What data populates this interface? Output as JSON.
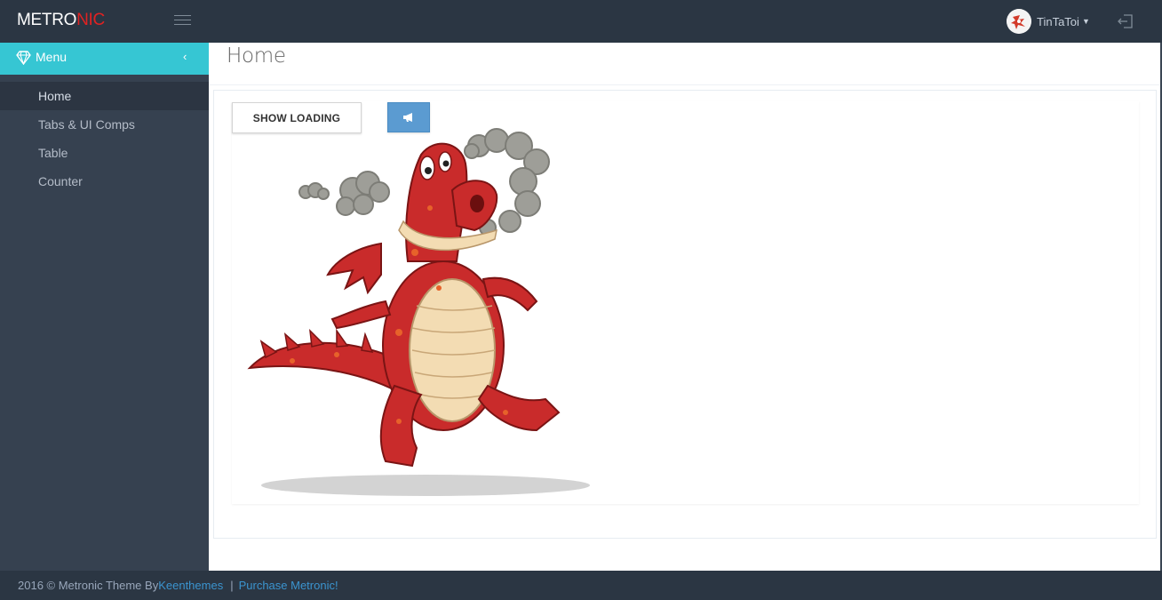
{
  "header": {
    "logo_main": "METRO",
    "logo_accent": "NIC",
    "username": "TinTaToi",
    "icons": [
      "hamburger-icon",
      "avatar",
      "chevron-down-icon",
      "logout-icon"
    ]
  },
  "sidebar": {
    "menu_label": "Menu",
    "items": [
      {
        "label": "Home",
        "active": true
      },
      {
        "label": "Tabs & UI Comps",
        "active": false
      },
      {
        "label": "Table",
        "active": false
      },
      {
        "label": "Counter",
        "active": false
      }
    ]
  },
  "main": {
    "page_title": "Home",
    "show_loading_label": "SHOW LOADING",
    "notify_icon": "bullhorn-icon",
    "image": "red-dragon-cartoon"
  },
  "footer": {
    "copyright": "2016 © Metronic Theme By",
    "author_link": "Keenthemes",
    "separator": "|",
    "purchase_link": "Purchase Metronic!"
  },
  "colors": {
    "topbar": "#2b3643",
    "sidebar": "#364150",
    "menu_header": "#36c6d3",
    "logo_accent": "#e02222",
    "notify_button": "#5b9bd1",
    "footer_link": "#3b94cf"
  }
}
